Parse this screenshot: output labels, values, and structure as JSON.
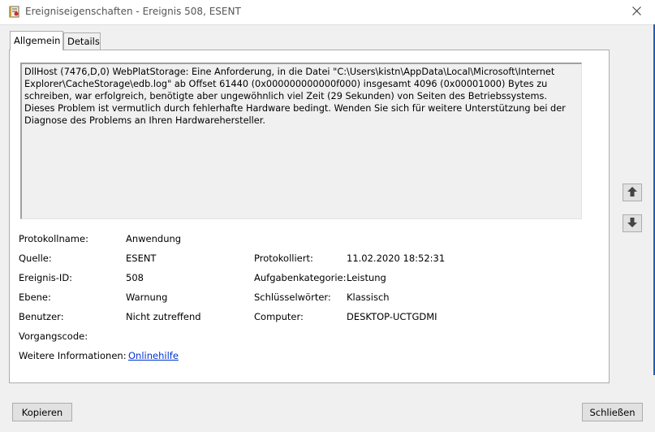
{
  "window": {
    "title": "Ereigniseigenschaften - Ereignis 508, ESENT",
    "icon": "event-viewer-icon",
    "close_icon": "close-icon"
  },
  "tabs": [
    {
      "label": "Allgemein",
      "active": true
    },
    {
      "label": "Details",
      "active": false
    }
  ],
  "description": "DllHost (7476,D,0) WebPlatStorage: Eine Anforderung, in die Datei \"C:\\Users\\kistn\\AppData\\Local\\Microsoft\\Internet Explorer\\CacheStorage\\edb.log\" ab Offset 61440 (0x000000000000f000) insgesamt 4096 (0x00001000) Bytes zu schreiben, war erfolgreich, benötigte aber ungewöhnlich viel Zeit (29 Sekunden) von Seiten des Betriebssystems. Dieses Problem ist vermutlich durch fehlerhafte Hardware bedingt. Wenden Sie sich für weitere Unterstützung bei der Diagnose des Problems an Ihren Hardwarehersteller.",
  "fields": {
    "protokollname_label": "Protokollname:",
    "protokollname_value": "Anwendung",
    "quelle_label": "Quelle:",
    "quelle_value": "ESENT",
    "protokolliert_label": "Protokolliert:",
    "protokolliert_value": "11.02.2020 18:52:31",
    "ereignis_id_label": "Ereignis-ID:",
    "ereignis_id_value": "508",
    "aufgabenkategorie_label": "Aufgabenkategorie:",
    "aufgabenkategorie_value": "Leistung",
    "ebene_label": "Ebene:",
    "ebene_value": "Warnung",
    "schluesselwoerter_label": "Schlüsselwörter:",
    "schluesselwoerter_value": "Klassisch",
    "benutzer_label": "Benutzer:",
    "benutzer_value": "Nicht zutreffend",
    "computer_label": "Computer:",
    "computer_value": "DESKTOP-UCTGDMI",
    "vorgangscode_label": "Vorgangscode:",
    "vorgangscode_value": "",
    "weitere_label": "Weitere Informationen:",
    "weitere_link": "Onlinehilfe"
  },
  "nav": {
    "up_icon": "arrow-up-icon",
    "down_icon": "arrow-down-icon"
  },
  "buttons": {
    "copy": "Kopieren",
    "close": "Schließen"
  },
  "colors": {
    "link": "#0033cc",
    "window_edge": "#1e5fb4"
  }
}
